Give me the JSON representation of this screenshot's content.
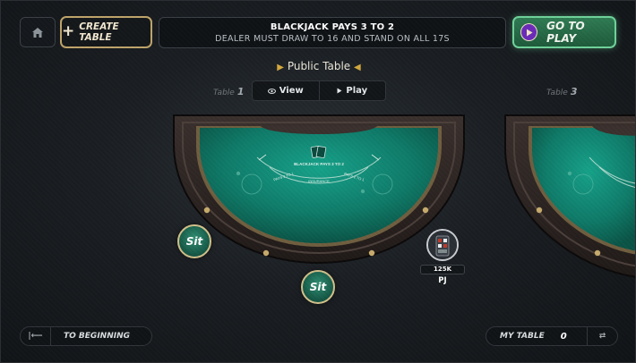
{
  "header": {
    "create_table_label": "CREATE TABLE",
    "rules_line1": "BLACKJACK PAYS 3 TO 2",
    "rules_line2": "DEALER MUST DRAW TO 16 AND STAND ON ALL 17S",
    "go_to_play_label": "GO TO PLAY"
  },
  "lobby": {
    "public_table_label": "Public Table",
    "view_label": "View",
    "play_label": "Play",
    "tables": [
      {
        "tag": "Table",
        "number": "1"
      },
      {
        "tag": "Table",
        "number": "3"
      }
    ]
  },
  "felt": {
    "payout_text": "BLACKJACK PAYS 3 TO 2",
    "pays_left": "PAYS 2 TO 1",
    "insurance": "INSURANCE",
    "pays_right": "PAYS 2 TO 1"
  },
  "seats": [
    {
      "label": "Sit"
    },
    {
      "label": "Sit"
    }
  ],
  "player": {
    "chips": "125K",
    "name": "PJ"
  },
  "footer": {
    "to_beginning_label": "TO BEGINNING",
    "my_table_label": "MY TABLE",
    "my_table_count": "0"
  },
  "colors": {
    "felt": "#0f7b69",
    "rail": "#2e2624",
    "gold": "#bfa46a",
    "play_green": "#2f7b53",
    "play_icon": "#6b2bb8"
  },
  "icons": [
    "home-icon",
    "plus-icon",
    "play-icon",
    "eye-icon",
    "play-triangle-icon",
    "card-icon",
    "arrow-to-start-icon",
    "swap-icon"
  ]
}
